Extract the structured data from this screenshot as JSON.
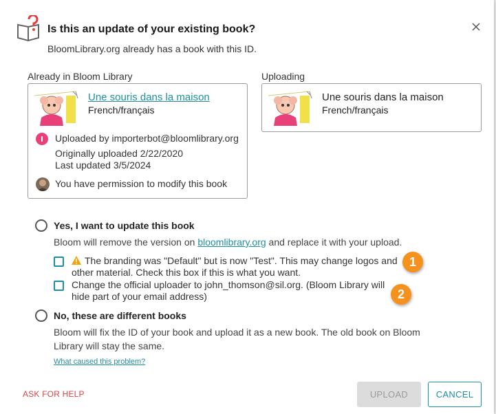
{
  "dialog": {
    "title": "Is this an update of your existing book?",
    "subtitle": "BloomLibrary.org already has a book with this ID.",
    "icons": {
      "title": "book-question-icon",
      "close": "close-icon"
    }
  },
  "existing": {
    "label": "Already in Bloom Library",
    "book_title": "Une souris dans la maison",
    "language": "French/français",
    "uploaded_by": "Uploaded by importerbot@bloomlibrary.org",
    "original_upload": "Originally uploaded 2/22/2020",
    "last_updated": "Last updated 3/5/2024",
    "permission": "You have permission to modify this book"
  },
  "uploading": {
    "label": "Uploading",
    "book_title": "Une souris dans la maison",
    "language": "French/français"
  },
  "option_update": {
    "title": "Yes, I want to update this book",
    "desc_before": "Bloom will remove the version on ",
    "desc_link": "bloomlibrary.org",
    "desc_after": " and replace it with your upload.",
    "branding_line1": "The branding was \"Default\" but is now \"Test\". This may change logos and",
    "branding_line2": "other material. Check this box if this is what you want.",
    "uploader_line1": "Change the official uploader to john_thomson@sil.org. (Bloom Library will",
    "uploader_line2": "hide part of your email address)"
  },
  "option_different": {
    "title": "No, these are different books",
    "desc_line1": "Bloom will fix the ID of your book and upload it as a new book. The old book on Bloom",
    "desc_line2": "Library will stay the same."
  },
  "links": {
    "problem": "What caused this problem?",
    "help": "ASK FOR HELP"
  },
  "buttons": {
    "upload": "UPLOAD",
    "cancel": "CANCEL"
  },
  "callouts": [
    "1",
    "2"
  ],
  "colors": {
    "accent": "#1d8fa1",
    "help": "#d64545",
    "callout": "#f5921e",
    "badge": "#e8417a",
    "warning": "#f0a30a"
  }
}
